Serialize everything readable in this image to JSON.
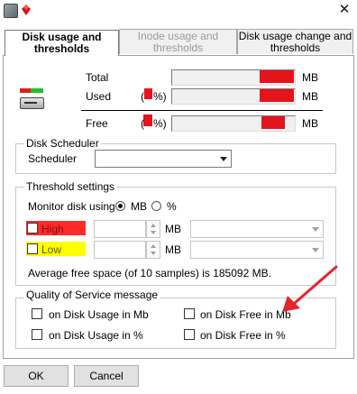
{
  "colors": {
    "redaction": "#e3141b",
    "high_highlight": "#ff2a2a",
    "low_highlight": "#ffff00",
    "annotation_arrow": "#e3262b"
  },
  "titlebar": {
    "app_icon": "disk-app-icon",
    "secondary_icon": "red-diamond-icon",
    "close_icon": "close-icon"
  },
  "tabs": [
    {
      "line1": "Disk usage and",
      "line2": "thresholds",
      "state": "active"
    },
    {
      "line1": "Inode usage and",
      "line2": "thresholds",
      "state": "disabled"
    },
    {
      "line1": "Disk usage change and",
      "line2": "thresholds",
      "state": "normal"
    }
  ],
  "usage": {
    "total_label": "Total",
    "used_label": "Used",
    "free_label": "Free",
    "paren_open": "(",
    "percent_close": "%)",
    "unit": "MB"
  },
  "disk_scheduler": {
    "title": "Disk Scheduler",
    "scheduler_label": "Scheduler",
    "scheduler_value": ""
  },
  "threshold": {
    "title": "Threshold settings",
    "monitor_label": "Monitor disk using",
    "mb_option": "MB",
    "percent_option": "%",
    "selected": "MB",
    "high_label": "High",
    "low_label": "Low",
    "unit": "MB",
    "high_value": "",
    "low_value": "",
    "average_text": "Average free space (of 10 samples) is 185092 MB."
  },
  "qos": {
    "title": "Quality of Service message",
    "options": [
      "on Disk Usage in Mb",
      "on Disk Free in Mb",
      "on Disk Usage in %",
      "on Disk Free in %"
    ]
  },
  "buttons": {
    "ok": "OK",
    "cancel": "Cancel"
  }
}
